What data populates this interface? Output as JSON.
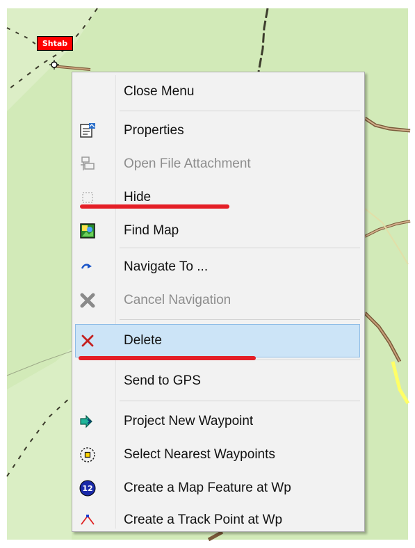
{
  "waypoint": {
    "label": "Shtab"
  },
  "menu": {
    "items": [
      {
        "label": "Close Menu",
        "icon": "none",
        "disabled": false
      },
      {
        "label": "Properties",
        "icon": "properties-icon",
        "disabled": false
      },
      {
        "label": "Open File Attachment",
        "icon": "attachment-icon",
        "disabled": true
      },
      {
        "label": "Hide",
        "icon": "hide-icon",
        "disabled": false
      },
      {
        "label": "Find Map",
        "icon": "find-map-icon",
        "disabled": false
      },
      {
        "label": "Navigate To ...",
        "icon": "navigate-icon",
        "disabled": false
      },
      {
        "label": "Cancel Navigation",
        "icon": "cancel-navigation-icon",
        "disabled": true
      },
      {
        "label": "Delete",
        "icon": "delete-icon",
        "disabled": false,
        "highlighted": true
      },
      {
        "label": "Send to GPS",
        "icon": "none",
        "disabled": false
      },
      {
        "label": "Project New Waypoint",
        "icon": "project-waypoint-icon",
        "disabled": false
      },
      {
        "label": "Select Nearest Waypoints",
        "icon": "select-nearest-icon",
        "disabled": false
      },
      {
        "label": "Create a Map Feature at Wp",
        "icon": "map-feature-icon",
        "disabled": false
      },
      {
        "label": "Create a Track Point at Wp",
        "icon": "track-point-icon",
        "disabled": false
      }
    ]
  },
  "colors": {
    "map_background": "#d2eab8",
    "highlight": "#cce4f7",
    "annotation_underline": "#e41e26",
    "waypoint_label_bg": "#ff0000"
  }
}
